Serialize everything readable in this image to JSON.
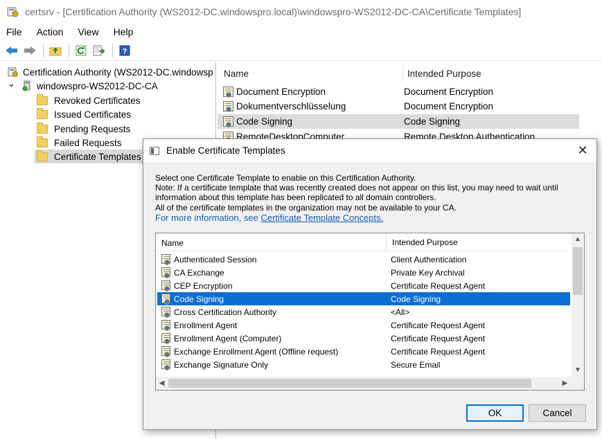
{
  "window": {
    "title": "certsrv - [Certification Authority (WS2012-DC.windowspro.local)\\windowspro-WS2012-DC-CA\\Certificate Templates]"
  },
  "menu": [
    "File",
    "Action",
    "View",
    "Help"
  ],
  "toolbar": {
    "icons": [
      "back-arrow-icon",
      "forward-arrow-icon",
      "up-folder-icon",
      "refresh-icon",
      "export-icon",
      "help-icon"
    ]
  },
  "tree": {
    "root": "Certification Authority (WS2012-DC.windowsp",
    "ca": "windowspro-WS2012-DC-CA",
    "expand_glyph": "⌄",
    "folders": [
      "Revoked Certificates",
      "Issued Certificates",
      "Pending Requests",
      "Failed Requests",
      "Certificate Templates"
    ],
    "selected": "Certificate Templates"
  },
  "main_list": {
    "columns": [
      "Name",
      "Intended Purpose"
    ],
    "rows": [
      {
        "name": "Document Encryption",
        "purpose": "Document Encryption"
      },
      {
        "name": "Dokumentverschlüsselung",
        "purpose": "Document Encryption"
      },
      {
        "name": "Code Signing",
        "purpose": "Code Signing"
      },
      {
        "name": "RemoteDesktopComputer",
        "purpose": "Remote Desktop Authentication"
      }
    ],
    "selected_index": 2
  },
  "dialog": {
    "title": "Enable Certificate Templates",
    "close_glyph": "✕",
    "text_lines": [
      "Select one Certificate Template to enable on this Certification Authority.",
      "Note: If a certificate template that was recently created does not appear on this list, you may need to wait until",
      "information about this template has been replicated to all domain controllers.",
      "All of the certificate templates in the organization may not be available to your CA."
    ],
    "link_prefix": "For more information, see ",
    "link_text": "Certificate Template Concepts.",
    "list": {
      "columns": [
        "Name",
        "Intended Purpose"
      ],
      "rows": [
        {
          "name": "Authenticated Session",
          "purpose": "Client Authentication"
        },
        {
          "name": "CA Exchange",
          "purpose": "Private Key Archival"
        },
        {
          "name": "CEP Encryption",
          "purpose": "Certificate Request Agent"
        },
        {
          "name": "Code  Signing",
          "purpose": "Code Signing"
        },
        {
          "name": "Cross Certification Authority",
          "purpose": "<All>"
        },
        {
          "name": "Enrollment Agent",
          "purpose": "Certificate Request Agent"
        },
        {
          "name": "Enrollment Agent (Computer)",
          "purpose": "Certificate Request Agent"
        },
        {
          "name": "Exchange Enrollment Agent (Offline request)",
          "purpose": "Certificate Request Agent"
        },
        {
          "name": "Exchange Signature Only",
          "purpose": "Secure Email"
        }
      ],
      "selected_index": 3,
      "scroll_glyphs": {
        "up": "▲",
        "down": "▼",
        "left": "◀",
        "right": "▶"
      }
    },
    "ok_label": "OK",
    "cancel_label": "Cancel"
  },
  "colors": {
    "selection_blue": "#0c6ed3",
    "link_blue": "#0f5fb0",
    "folder_yellow": "#f3cf63",
    "dialog_bg": "#f0f0f0"
  }
}
